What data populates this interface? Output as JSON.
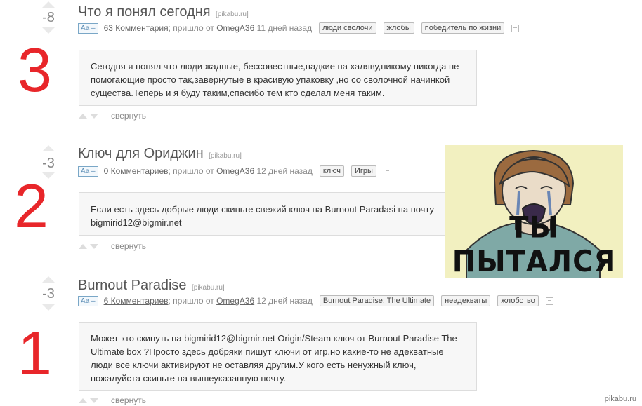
{
  "posts": [
    {
      "rank": "3",
      "rating": "-8",
      "title": "Что я понял сегодня",
      "source": "[pikabu.ru]",
      "aa": "Aa –",
      "comments": "63 Комментария",
      "came_from": "; пришло от",
      "author": "OmegA36",
      "time": "11 дней назад",
      "tags": [
        "люди сволочи",
        "жлобы",
        "победитель по жизни"
      ],
      "text": "Сегодня я понял что люди жадные, бессовестные,падкие на халяву,никому никогда не помогающие просто так,завернутые в красивую упаковку ,но со сволочной начинкой существа.Теперь и я буду таким,спасибо тем кто сделал меня таким.",
      "collapse": "свернуть"
    },
    {
      "rank": "2",
      "rating": "-3",
      "title": "Ключ для Ориджин",
      "source": "[pikabu.ru]",
      "aa": "Aa –",
      "comments": "0 Комментариев",
      "came_from": "; пришло от",
      "author": "OmegA36",
      "time": "12 дней назад",
      "tags": [
        "ключ",
        "Игры"
      ],
      "text": "Если есть здесь добрые люди скиньте свежий ключ на Burnout Paradasi на почту bigmirid12@bigmir.net",
      "collapse": "свернуть"
    },
    {
      "rank": "1",
      "rating": "-3",
      "title": "Burnout Paradise",
      "source": "[pikabu.ru]",
      "aa": "Aa –",
      "comments": "6 Комментариев",
      "came_from": "; пришло от",
      "author": "OmegA36",
      "time": "12 дней назад",
      "tags": [
        "Burnout Paradise: The Ultimate",
        "неадекваты",
        "жлобство"
      ],
      "text": "Может кто скинуть на bigmirid12@bigmir.net Origin/Steam ключ от Burnout Paradise The Ultimate box ?Просто здесь добряки пишут ключи от игр,но какие-то не адекватные люди все ключи активируют не оставляя другим.У кого есть ненужный ключ, пожалуйста скиньте на вышеуказанную почту.",
      "collapse": "свернуть"
    }
  ],
  "meme": {
    "caption": "ТЫ ПЫТАЛСЯ"
  },
  "watermark": "pikabu.ru",
  "colors": {
    "rank": "#e8262a",
    "meme_bg": "#f2f0c0"
  }
}
